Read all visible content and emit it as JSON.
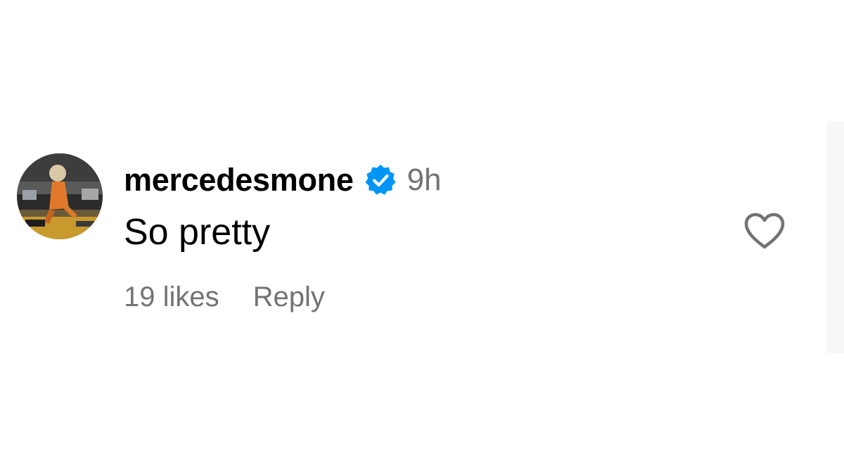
{
  "comment": {
    "username": "mercedesmone",
    "verified": true,
    "time": "9h",
    "text": "So pretty",
    "likes_label": "19 likes",
    "reply_label": "Reply"
  },
  "icons": {
    "verified_badge": "verified-badge-icon",
    "like": "heart-outline-icon"
  },
  "colors": {
    "text_primary": "#000000",
    "text_secondary": "#737373",
    "verified_blue": "#0095f6",
    "heart_stroke": "#737373"
  }
}
